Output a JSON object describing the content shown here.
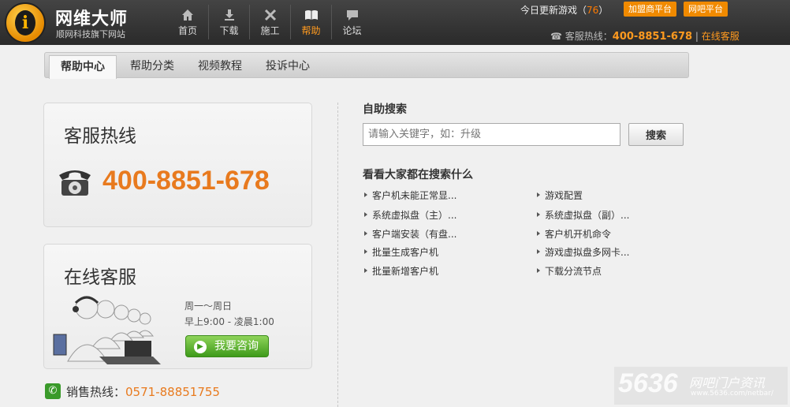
{
  "header": {
    "logo_mark": "i",
    "title": "网维大师",
    "subtitle": "顺网科技旗下网站",
    "nav": [
      {
        "label": "首页",
        "icon": "home-icon"
      },
      {
        "label": "下载",
        "icon": "download-icon"
      },
      {
        "label": "施工",
        "icon": "tools-icon"
      },
      {
        "label": "帮助",
        "icon": "book-icon",
        "active": true
      },
      {
        "label": "论坛",
        "icon": "chat-icon"
      }
    ],
    "update_prefix": "今日更新游戏（",
    "update_count": "76",
    "update_suffix": "）",
    "partner_btn": "加盟商平台",
    "netbar_btn": "网吧平台",
    "hotline_label": "客服热线：",
    "hotline_number": "400-8851-678",
    "separator": " | ",
    "online_link": "在线客服"
  },
  "tabs": [
    {
      "label": "帮助中心",
      "active": true
    },
    {
      "label": "帮助分类"
    },
    {
      "label": "视频教程"
    },
    {
      "label": "投诉中心"
    }
  ],
  "hotline_box": {
    "title": "客服热线",
    "number": "400-8851-678"
  },
  "online_box": {
    "title": "在线客服",
    "hours_days": "周一～周日",
    "hours_time": "早上9:00 - 凌晨1:00",
    "consult_btn": "我要咨询"
  },
  "sales": {
    "label": "销售热线：",
    "number": "0571-88851755"
  },
  "search": {
    "title": "自助搜索",
    "placeholder": "请输入关键字，如：升级",
    "button": "搜索"
  },
  "popular": {
    "title": "看看大家都在搜索什么",
    "left": [
      "客户机未能正常显...",
      "系统虚拟盘（主）...",
      "客户端安装（有盘...",
      "批量生成客户机",
      "批量新增客户机"
    ],
    "right": [
      "游戏配置",
      "系统虚拟盘（副）...",
      "客户机开机命令",
      "游戏虚拟盘多网卡...",
      "下载分流节点"
    ]
  },
  "watermark": {
    "big": "5636",
    "cn": "网吧门户资讯",
    "url": "www.5636.com/netbar/"
  },
  "colors": {
    "accent": "#e87a1e",
    "header_bg": "#2a2a2a",
    "nav_active": "#ff9a1f",
    "consult_green": "#3e9a1a"
  }
}
